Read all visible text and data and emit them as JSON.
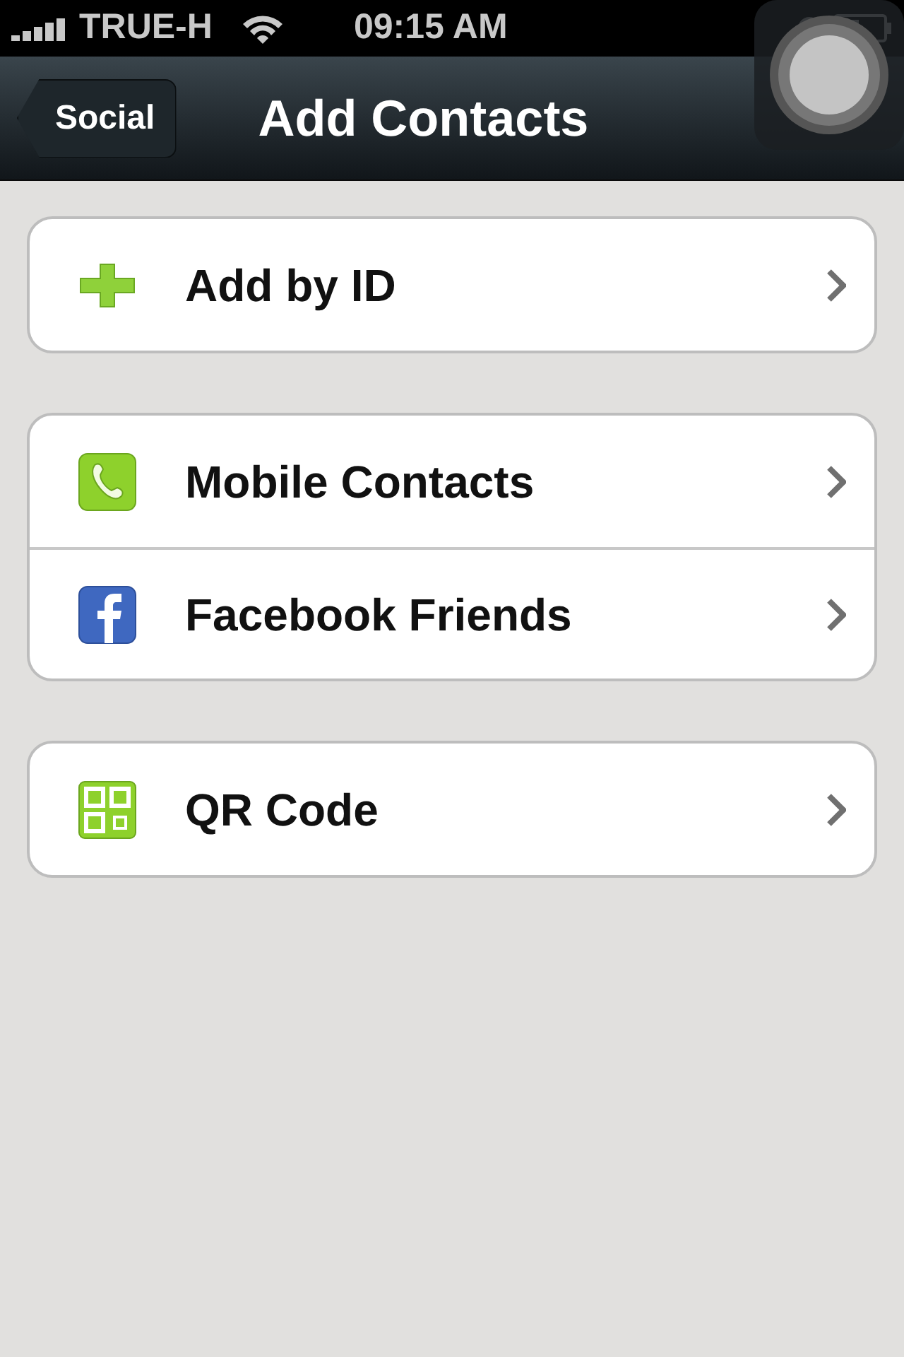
{
  "status_bar": {
    "carrier": "TRUE-H",
    "time": "09:15 AM"
  },
  "nav": {
    "back": "Social",
    "title": "Add Contacts"
  },
  "groups": [
    {
      "items": [
        {
          "kind": "plus",
          "label": "Add by ID"
        }
      ]
    },
    {
      "items": [
        {
          "kind": "phone",
          "label": "Mobile Contacts"
        },
        {
          "kind": "facebook",
          "label": "Facebook Friends"
        }
      ]
    },
    {
      "items": [
        {
          "kind": "qr",
          "label": "QR Code"
        }
      ]
    }
  ]
}
